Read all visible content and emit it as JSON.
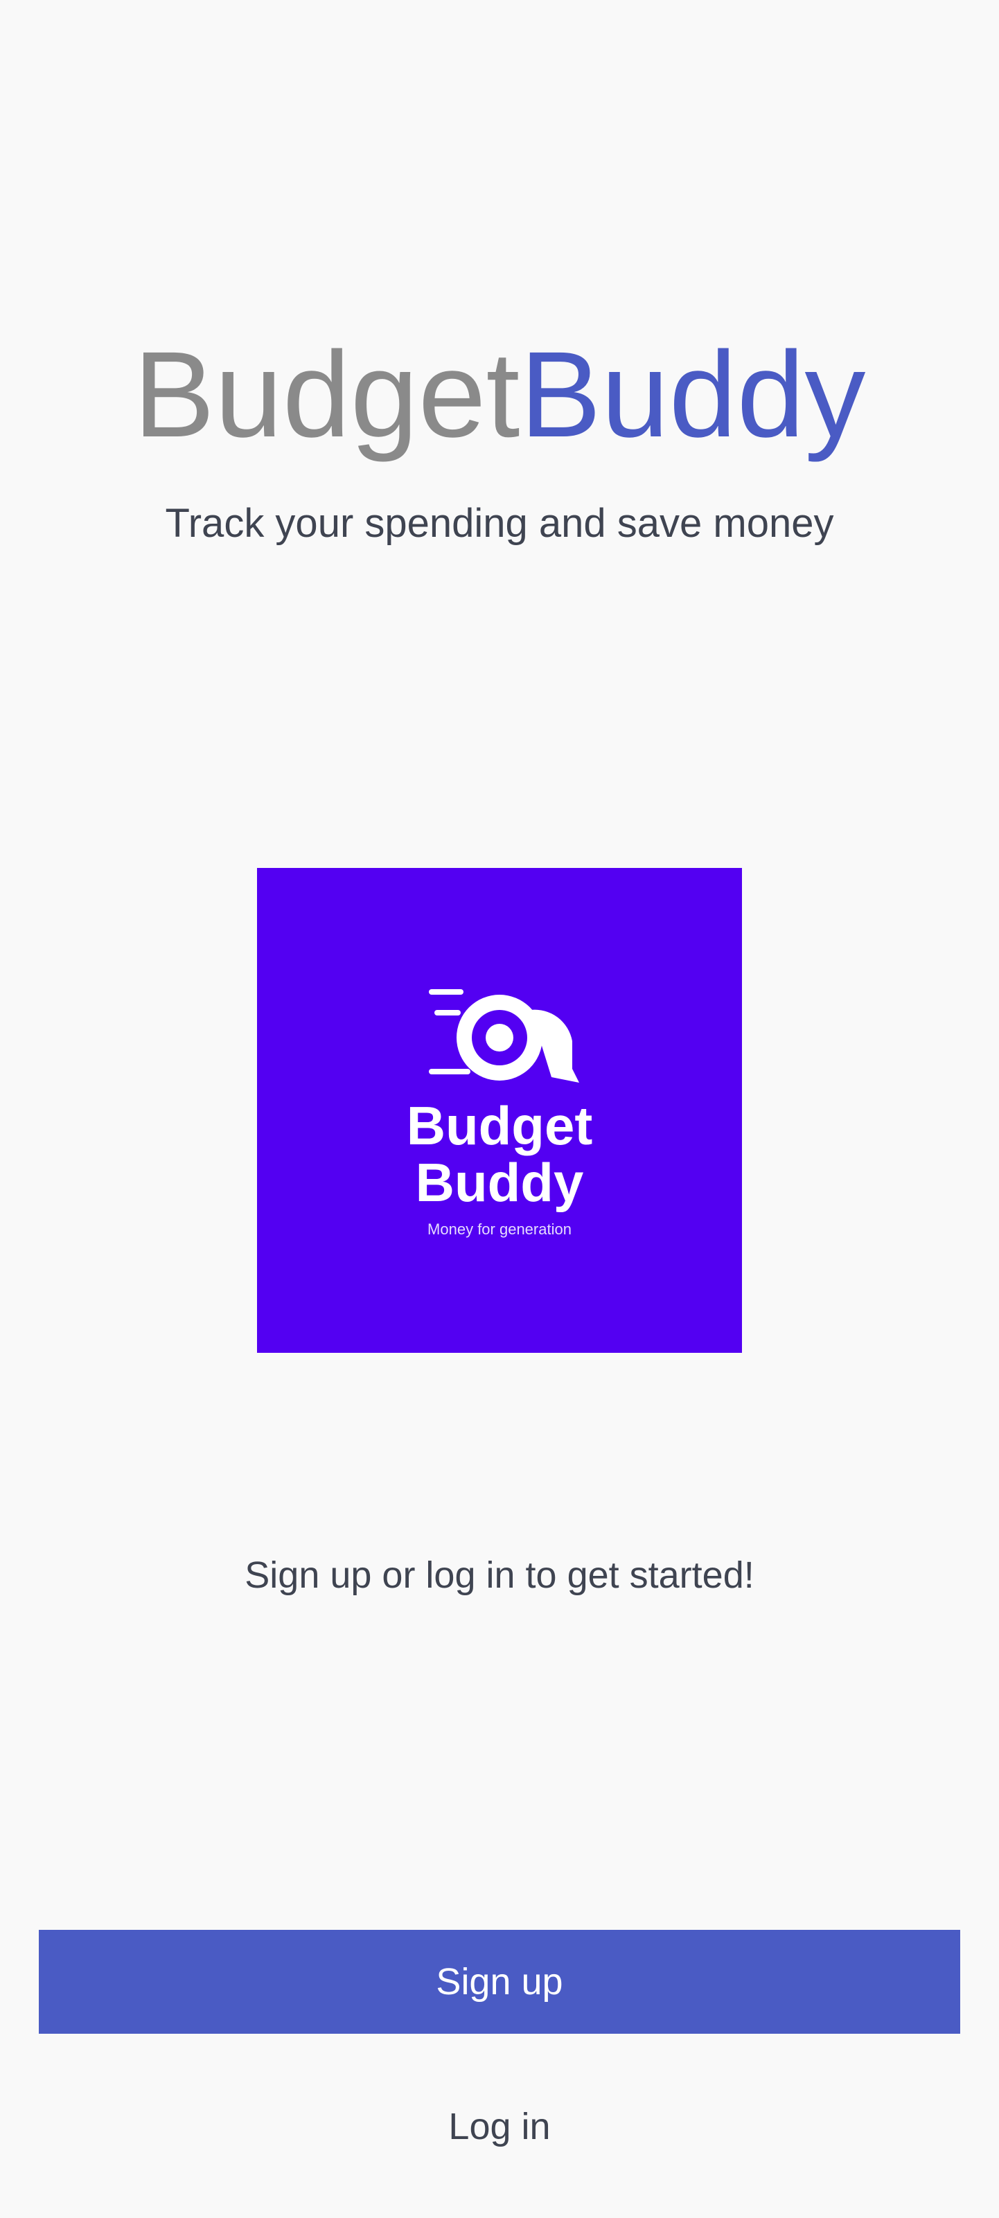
{
  "header": {
    "title_part1": "Budget",
    "title_part2": "Buddy",
    "subtitle": "Track your spending and save money"
  },
  "logo": {
    "icon": "budgetbuddy-logo",
    "word1": "Budget",
    "word2": "Buddy",
    "tagline": "Money for generation"
  },
  "main": {
    "prompt": "Sign up or log in to get started!"
  },
  "actions": {
    "signup_label": "Sign up",
    "login_label": "Log in"
  },
  "colors": {
    "accent": "#4a5bc4",
    "logo_bg": "#5300f2",
    "title_gray": "#8a8a8a",
    "text": "#3f4451",
    "background": "#f9f9f9"
  }
}
